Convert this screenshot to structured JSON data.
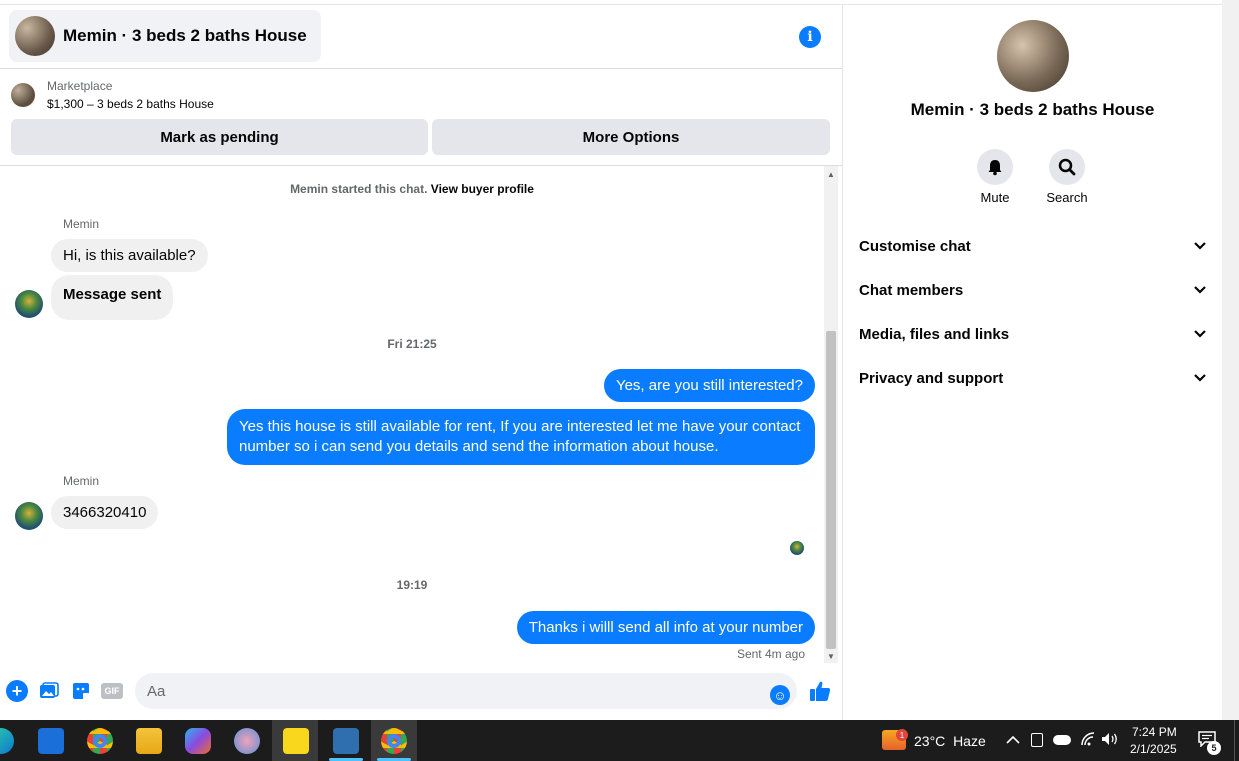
{
  "header": {
    "title": "Memin · 3 beds 2 baths House"
  },
  "listing": {
    "label": "Marketplace",
    "title": "$1,300 – 3 beds 2 baths House",
    "pending_button": "Mark as pending",
    "more_button": "More Options"
  },
  "conversation": {
    "system_prefix": "Memin started this chat.",
    "system_link": "View buyer profile",
    "sender_name": "Memin",
    "msg1": "Hi, is this available?",
    "msg2": "Message sent",
    "time1": "Fri 21:25",
    "out1": "Yes, are you still interested?",
    "out2": "Yes this house is still available for rent,  If you are interested  let me have your contact number so i can send you details and send the information about house.",
    "sender_name2": "Memin",
    "msg3": "3466320410",
    "time2": "19:19",
    "out3": "Thanks i willl send all info at your number",
    "sent_status": "Sent 4m ago"
  },
  "composer": {
    "placeholder": "Aa",
    "gif_label": "GIF"
  },
  "panel": {
    "title": "Memin · 3 beds 2 baths House",
    "mute_label": "Mute",
    "search_label": "Search",
    "items": [
      "Customise chat",
      "Chat members",
      "Media, files and links",
      "Privacy and support"
    ]
  },
  "taskbar": {
    "weather": "23°C",
    "weather_desc": "Haze",
    "weather_badge": "1",
    "time": "7:24 PM",
    "date": "2/1/2025",
    "notification_count": "5"
  },
  "colors": {
    "accent": "#0a7cff",
    "bubble_in": "#f0f0f0",
    "taskbar": "#1c1c1c"
  }
}
